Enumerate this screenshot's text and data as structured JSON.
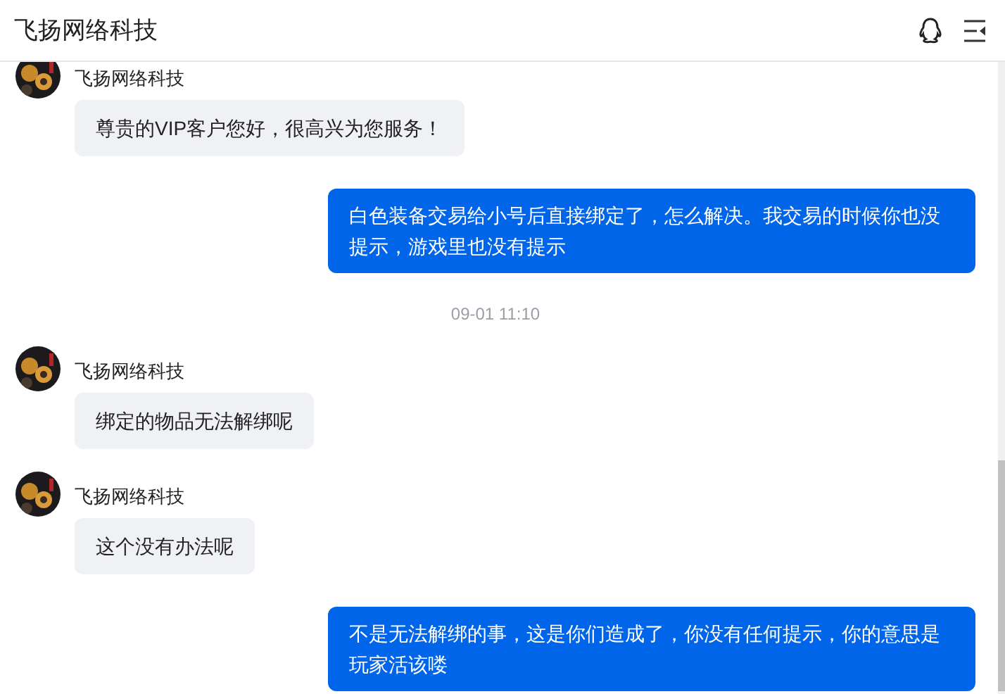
{
  "header": {
    "title": "飞扬网络科技"
  },
  "messages": [
    {
      "kind": "agent",
      "name": "飞扬网络科技",
      "text": "尊贵的VIP客户您好，很高兴为您服务！"
    },
    {
      "kind": "user",
      "text": "白色装备交易给小号后直接绑定了，怎么解决。我交易的时候你也没提示，游戏里也没有提示"
    },
    {
      "kind": "time",
      "text": "09-01 11:10"
    },
    {
      "kind": "agent",
      "name": "飞扬网络科技",
      "text": "绑定的物品无法解绑呢"
    },
    {
      "kind": "agent",
      "name": "飞扬网络科技",
      "text": "这个没有办法呢"
    },
    {
      "kind": "user",
      "text": "不是无法解绑的事，这是你们造成了，你没有任何提示，你的意思是玩家活该喽"
    }
  ]
}
